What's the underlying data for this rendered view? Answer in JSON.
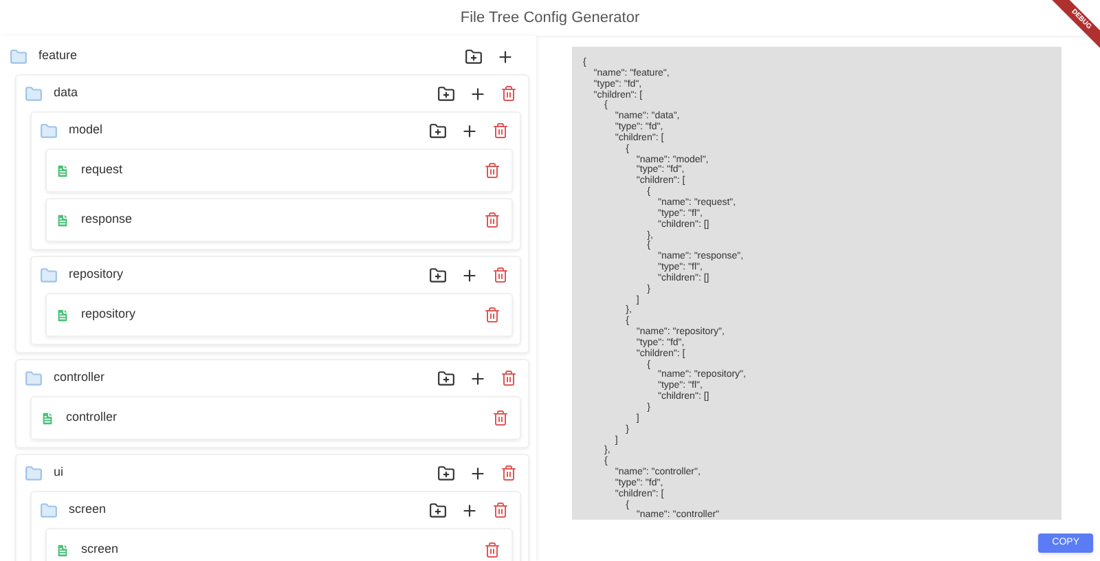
{
  "window": {
    "title": "File Tree Config Generator",
    "banner": "DEBUG"
  },
  "tree": {
    "name": "feature",
    "kind": "folder",
    "children": [
      {
        "name": "data",
        "kind": "folder",
        "children": [
          {
            "name": "model",
            "kind": "folder",
            "children": [
              {
                "name": "request",
                "kind": "file"
              },
              {
                "name": "response",
                "kind": "file"
              }
            ]
          },
          {
            "name": "repository",
            "kind": "folder",
            "children": [
              {
                "name": "repository",
                "kind": "file"
              }
            ]
          }
        ]
      },
      {
        "name": "controller",
        "kind": "folder",
        "children": [
          {
            "name": "controller",
            "kind": "file"
          }
        ]
      },
      {
        "name": "ui",
        "kind": "folder",
        "children": [
          {
            "name": "screen",
            "kind": "folder",
            "children": [
              {
                "name": "screen",
                "kind": "file"
              }
            ]
          }
        ]
      }
    ]
  },
  "output": {
    "code": "{\n    \"name\": \"feature\",\n    \"type\": \"fd\",\n    \"children\": [\n        {\n            \"name\": \"data\",\n            \"type\": \"fd\",\n            \"children\": [\n                {\n                    \"name\": \"model\",\n                    \"type\": \"fd\",\n                    \"children\": [\n                        {\n                            \"name\": \"request\",\n                            \"type\": \"fl\",\n                            \"children\": []\n                        },\n                        {\n                            \"name\": \"response\",\n                            \"type\": \"fl\",\n                            \"children\": []\n                        }\n                    ]\n                },\n                {\n                    \"name\": \"repository\",\n                    \"type\": \"fd\",\n                    \"children\": [\n                        {\n                            \"name\": \"repository\",\n                            \"type\": \"fl\",\n                            \"children\": []\n                        }\n                    ]\n                }\n            ]\n        },\n        {\n            \"name\": \"controller\",\n            \"type\": \"fd\",\n            \"children\": [\n                {\n                    \"name\": \"controller\"",
    "copy_button": "COPY"
  }
}
